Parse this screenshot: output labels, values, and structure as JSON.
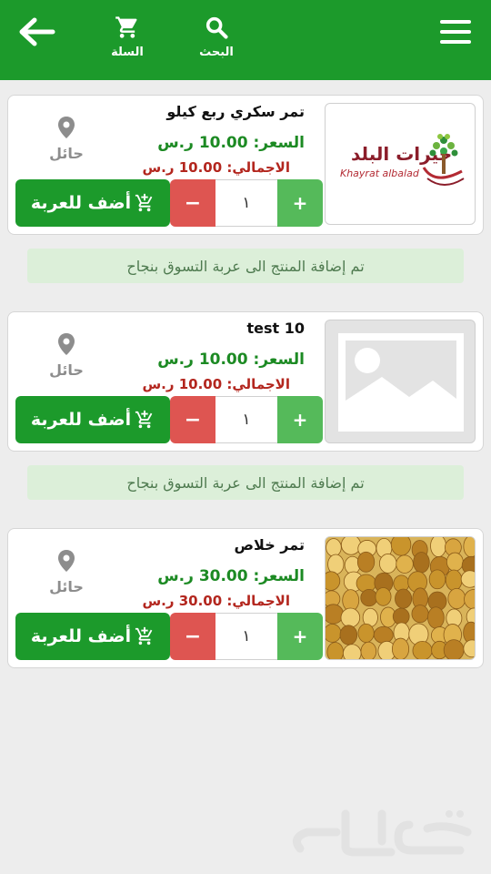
{
  "header": {
    "back_icon": "arrow-left-icon",
    "cart_label": "السلة",
    "search_label": "البحث",
    "menu_icon": "hamburger-menu-icon",
    "colors": {
      "bar": "#1c9a2b",
      "text": "#ffffff"
    }
  },
  "products": [
    {
      "title": "تمر سكري ربع كيلو",
      "price": "السعر: 10.00 ر.س",
      "total": "الاجمالي: 10.00 ر.س",
      "location": "حائل",
      "quantity": "١",
      "minus": "−",
      "plus": "+",
      "add_label": "أضف للعربة",
      "image": "khayrat-albalad-logo",
      "logo_text_ar": "خيرات البلد",
      "logo_text_en": "Khayrat albalad"
    },
    {
      "title": "test 10",
      "price": "السعر: 10.00 ر.س",
      "total": "الاجمالي: 10.00 ر.س",
      "location": "حائل",
      "quantity": "١",
      "minus": "−",
      "plus": "+",
      "add_label": "أضف للعربة",
      "image": "image-placeholder-icon"
    },
    {
      "title": "تمر خلاص",
      "price": "السعر: 30.00 ر.س",
      "total": "الاجمالي: 30.00 ر.س",
      "location": "حائل",
      "quantity": "١",
      "minus": "−",
      "plus": "+",
      "add_label": "أضف للعربة",
      "image": "dates-photo"
    }
  ],
  "toasts": [
    "تم إضافة المنتج الى عربة التسوق بنجاح",
    "تم إضافة المنتج الى عربة التسوق بنجاح"
  ],
  "colors": {
    "price": "#1c8a23",
    "total": "#b3261e",
    "add_button": "#1c9a2b",
    "minus_button": "#de5551",
    "plus_button": "#55ba5a",
    "toast_bg": "#dcefd9"
  }
}
